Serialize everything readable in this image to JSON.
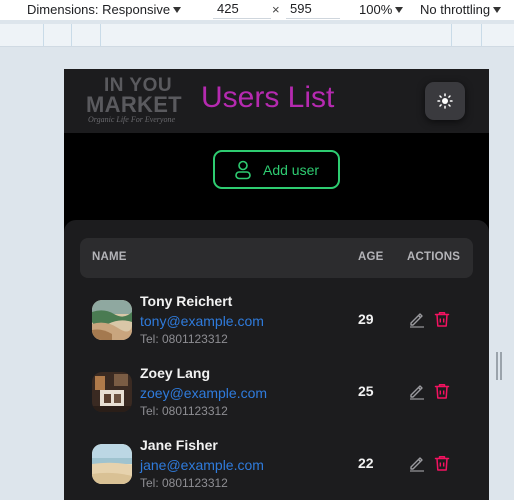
{
  "devtools": {
    "dimensions_label": "Dimensions: Responsive",
    "width": "425",
    "times": "×",
    "height": "595",
    "zoom": "100%",
    "throttling": "No throttling"
  },
  "app": {
    "logo": {
      "line1": "IN YOU",
      "line2": "MARKET",
      "tagline": "Organic Life For Everyone"
    },
    "title": "Users List",
    "add_user_label": "Add user",
    "accent_color": "#b52ab0",
    "button_color": "#2ecc71"
  },
  "table": {
    "headers": {
      "name": "NAME",
      "age": "AGE",
      "actions": "ACTIONS"
    },
    "rows": [
      {
        "name": "Tony Reichert",
        "email": "tony@example.com",
        "tel": "Tel: 0801123312",
        "age": "29"
      },
      {
        "name": "Zoey Lang",
        "email": "zoey@example.com",
        "tel": "Tel: 0801123312",
        "age": "25"
      },
      {
        "name": "Jane Fisher",
        "email": "jane@example.com",
        "tel": "Tel: 0801123312",
        "age": "22"
      }
    ]
  }
}
